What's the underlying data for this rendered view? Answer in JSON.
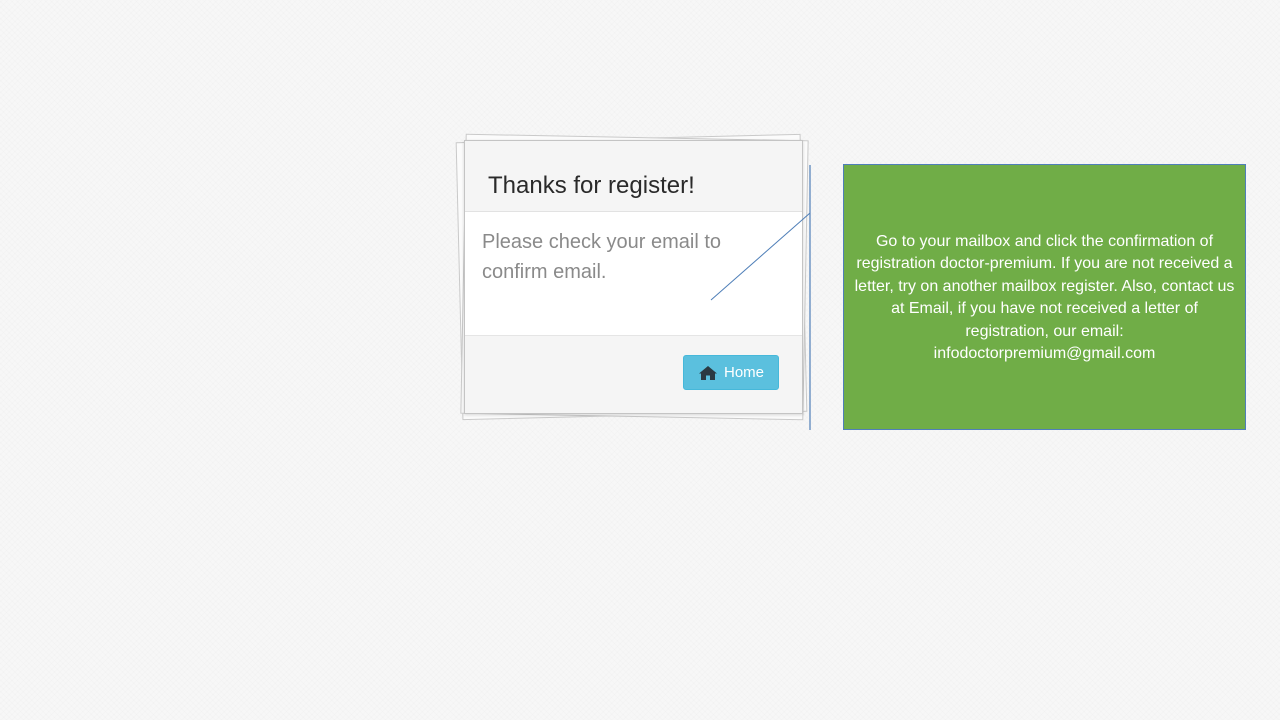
{
  "dialog": {
    "title": "Thanks for register!",
    "message": "Please check your email to confirm email.",
    "home_button": {
      "label": "Home",
      "icon": "home-icon"
    }
  },
  "callout": {
    "text": "Go to your mailbox and click the confirmation of registration doctor-premium. If you are not received a letter, try on another mailbox register. Also, contact us at Email, if you have not received a letter of registration, our email: infodoctorpremium@gmail.com",
    "background_color": "#70ad47",
    "border_color": "#4f7fb8",
    "text_color": "#ffffff"
  },
  "colors": {
    "button": "#5bc0de",
    "line": "#4f7fb8"
  }
}
